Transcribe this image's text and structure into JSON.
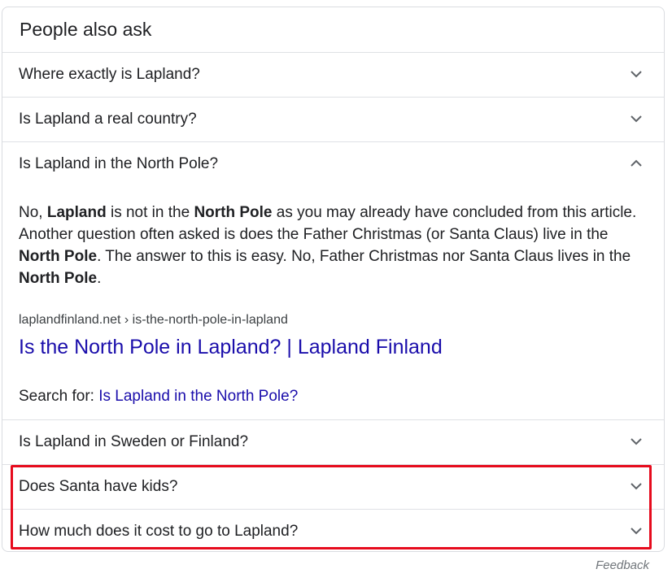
{
  "heading": "People also ask",
  "questions": [
    {
      "label": "Where exactly is Lapland?"
    },
    {
      "label": "Is Lapland a real country?"
    },
    {
      "label": "Is Lapland in the North Pole?"
    },
    {
      "label": "Is Lapland in Sweden or Finland?"
    },
    {
      "label": "Does Santa have kids?"
    },
    {
      "label": "How much does it cost to go to Lapland?"
    }
  ],
  "answer": {
    "p1": "No, ",
    "b1": "Lapland",
    "p2": " is not in the ",
    "b2": "North Pole",
    "p3": " as you may already have concluded from this article. Another question often asked is does the Father Christmas (or Santa Claus) live in the ",
    "b3": "North Pole",
    "p4": ". The answer to this is easy. No, Father Christmas nor Santa Claus lives in the ",
    "b4": "North Pole",
    "p5": "."
  },
  "source": {
    "breadcrumb": "laplandfinland.net › is-the-north-pole-in-lapland",
    "title": "Is the North Pole in Lapland? | Lapland Finland"
  },
  "search_for": {
    "prefix": "Search for: ",
    "query": "Is Lapland in the North Pole?"
  },
  "feedback": "Feedback",
  "colors": {
    "link": "#1a0dab",
    "highlight": "#e60b1d",
    "divider": "#dfe1e5"
  }
}
